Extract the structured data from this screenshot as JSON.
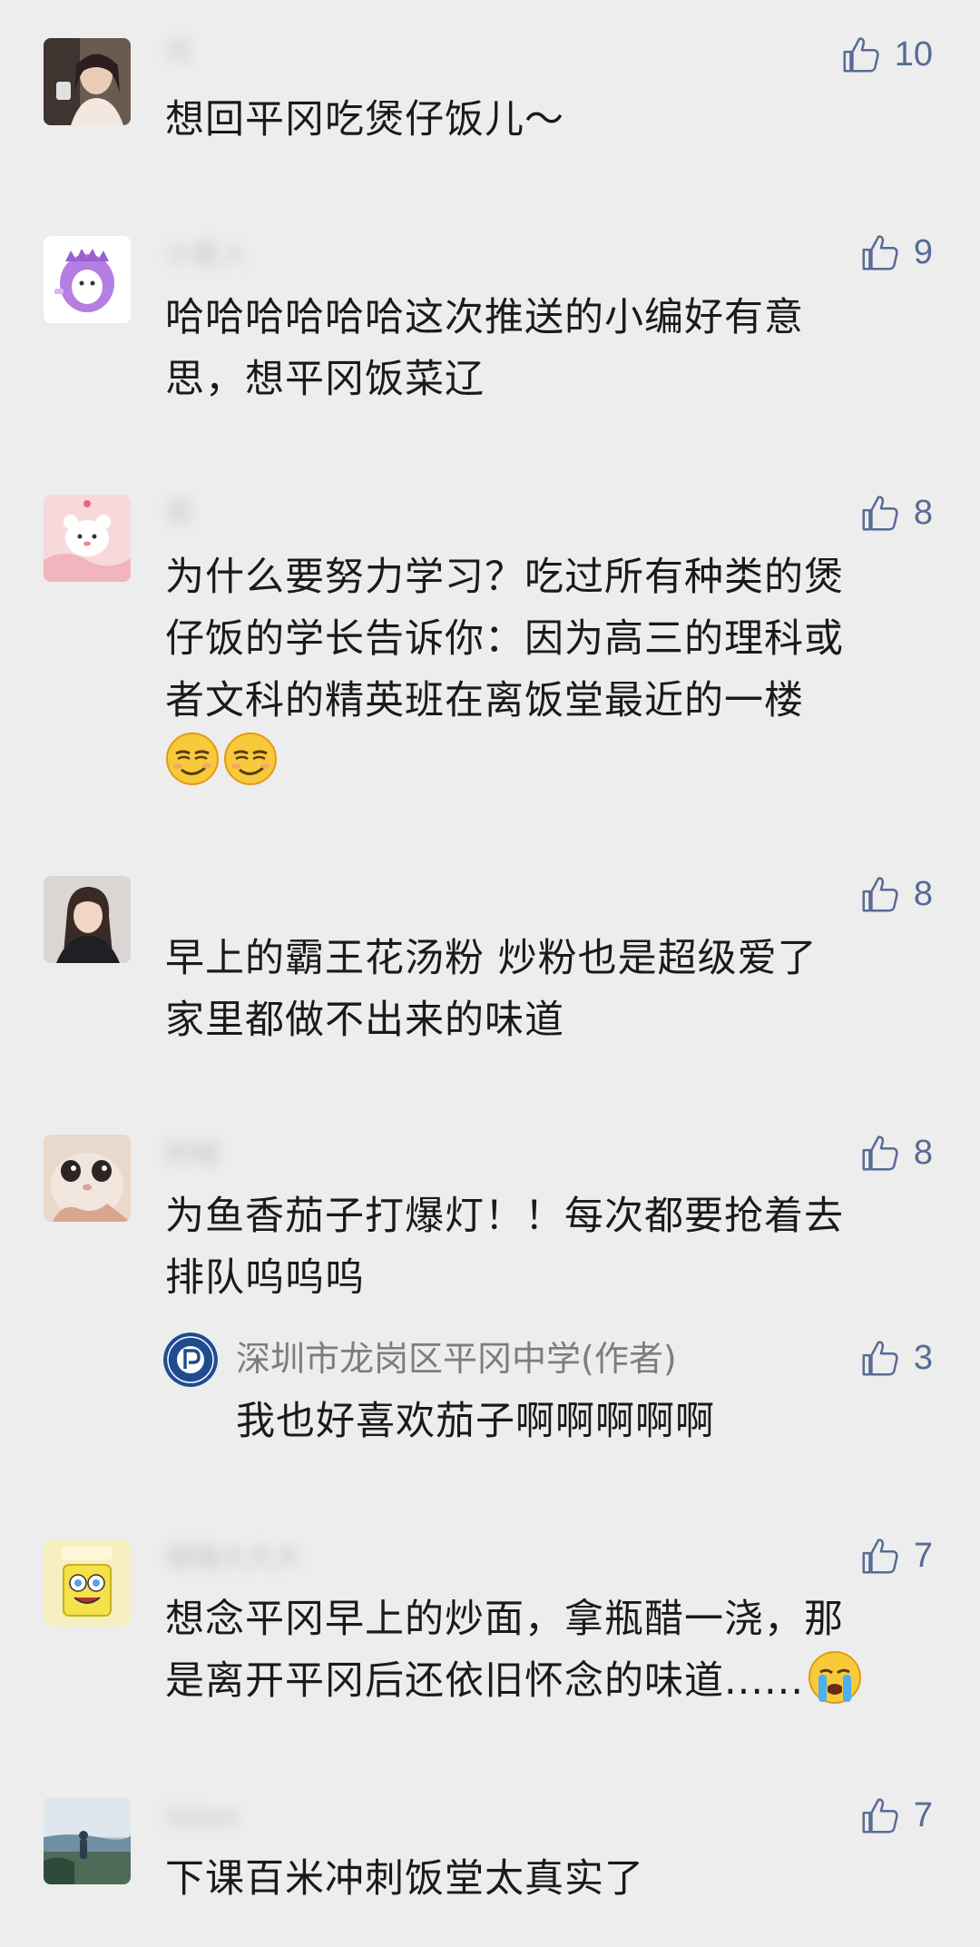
{
  "comments": [
    {
      "avatar": "avatar-girl-portrait",
      "nickname": "光",
      "likes": "10",
      "lines": [
        "想回平冈吃煲仔饭儿～"
      ]
    },
    {
      "avatar": "avatar-purple-dinosaur",
      "nickname": "小星人",
      "likes": "9",
      "lines": [
        "哈哈哈哈哈哈这次推送的小编好有意",
        "思，想平冈饭菜辽"
      ]
    },
    {
      "avatar": "avatar-pink-bear",
      "nickname": "诺",
      "likes": "8",
      "lines": [
        "为什么要努力学习？吃过所有种类的煲",
        "仔饭的学长告诉你：因为高三的理科或",
        "者文科的精英班在离饭堂最近的一楼"
      ],
      "emojis": [
        "smirk-emoji",
        "smirk-emoji"
      ]
    },
    {
      "avatar": "avatar-girl-dark",
      "nickname": "",
      "likes": "8",
      "lines": [
        "早上的霸王花汤粉 炒粉也是超级爱了",
        "家里都做不出来的味道"
      ]
    },
    {
      "avatar": "avatar-kitten",
      "nickname": "阿喵",
      "likes": "8",
      "lines": [
        "为鱼香茄子打爆灯！！每次都要抢着去",
        "排队呜呜呜"
      ],
      "reply": {
        "avatar": "school-logo",
        "name": "深圳市龙岗区平冈中学(作者)",
        "likes": "3",
        "text": "我也好喜欢茄子啊啊啊啊啊"
      }
    },
    {
      "avatar": "avatar-spongebob",
      "nickname": "喵喵大大大",
      "likes": "7",
      "lines": [
        "想念平冈早上的炒面，拿瓶醋一浇，那",
        "是离开平冈后还依旧怀念的味道......"
      ],
      "emojis": [
        "crying-emoji"
      ]
    },
    {
      "avatar": "avatar-lake",
      "nickname": "listen",
      "likes": "7",
      "lines": [
        "下课百米冲刺饭堂太真实了"
      ]
    }
  ],
  "colors": {
    "background": "#ededed",
    "like_blue": "#576b95",
    "text": "#1a1a1a"
  }
}
